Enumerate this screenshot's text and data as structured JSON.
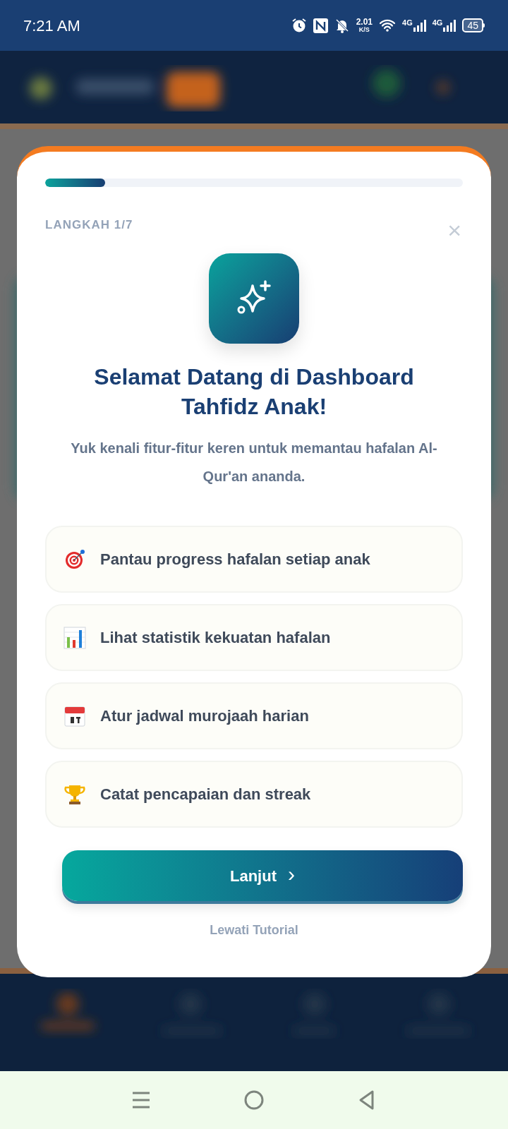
{
  "status_bar": {
    "time": "7:21 AM",
    "speed_value": "2.01",
    "speed_unit": "K/S",
    "networks": [
      "4G",
      "4G"
    ],
    "battery": "45"
  },
  "tutorial": {
    "progress": {
      "level": 0.143
    },
    "step_label": "LANGKAH 1/7",
    "close": "×",
    "title": "Selamat Datang di Dashboard Tahfidz Anak!",
    "subtitle": "Yuk kenali fitur-fitur keren untuk memantau hafalan Al-Qur'an ananda.",
    "features": [
      {
        "kind": "target",
        "label": "Pantau progress hafalan setiap anak"
      },
      {
        "kind": "chart",
        "label": "Lihat statistik kekuatan hafalan"
      },
      {
        "kind": "calendar",
        "label": "Atur jadwal murojaah harian"
      },
      {
        "kind": "trophy",
        "label": "Catat pencapaian dan streak"
      }
    ],
    "next_button": {
      "label": "Lanjut",
      "arrow": "›"
    },
    "skip_link": "Lewati Tutorial"
  }
}
